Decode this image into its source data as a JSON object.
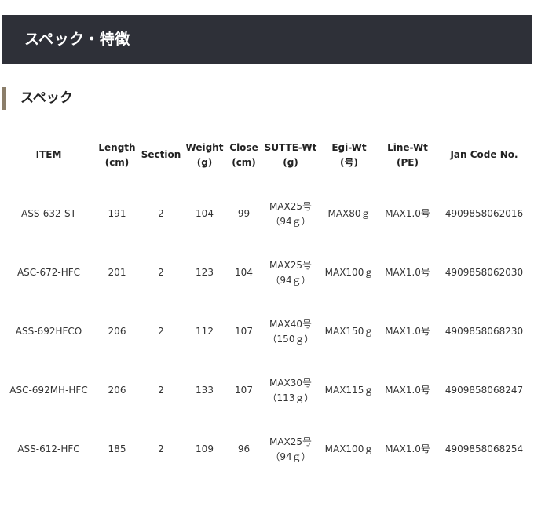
{
  "header": {
    "title": "スペック・特徴"
  },
  "section": {
    "title": "スペック"
  },
  "table": {
    "columns": [
      [
        "ITEM"
      ],
      [
        "Length",
        "(cm)"
      ],
      [
        "Section"
      ],
      [
        "Weight",
        "(g)"
      ],
      [
        "Close",
        "(cm)"
      ],
      [
        "SUTTE-Wt",
        "(g)"
      ],
      [
        "Egi-Wt",
        "(号)"
      ],
      [
        "Line-Wt",
        "(PE)"
      ],
      [
        "Jan Code No."
      ]
    ],
    "rows": [
      {
        "item": "ASS-632-ST",
        "length": "191",
        "section": "2",
        "weight": "104",
        "close": "99",
        "sutte_wt": [
          "MAX25号",
          "（94ｇ）"
        ],
        "egi_wt": "MAX80ｇ",
        "line_wt": "MAX1.0号",
        "jan": "4909858062016"
      },
      {
        "item": "ASC-672-HFC",
        "length": "201",
        "section": "2",
        "weight": "123",
        "close": "104",
        "sutte_wt": [
          "MAX25号",
          "（94ｇ）"
        ],
        "egi_wt": "MAX100ｇ",
        "line_wt": "MAX1.0号",
        "jan": "4909858062030"
      },
      {
        "item": "ASS-692HFCO",
        "length": "206",
        "section": "2",
        "weight": "112",
        "close": "107",
        "sutte_wt": [
          "MAX40号",
          "（150ｇ）"
        ],
        "egi_wt": "MAX150ｇ",
        "line_wt": "MAX1.0号",
        "jan": "4909858068230"
      },
      {
        "item": "ASC-692MH-HFC",
        "length": "206",
        "section": "2",
        "weight": "133",
        "close": "107",
        "sutte_wt": [
          "MAX30号",
          "（113ｇ）"
        ],
        "egi_wt": "MAX115ｇ",
        "line_wt": "MAX1.0号",
        "jan": "4909858068247"
      },
      {
        "item": "ASS-612-HFC",
        "length": "185",
        "section": "2",
        "weight": "109",
        "close": "96",
        "sutte_wt": [
          "MAX25号",
          "（94ｇ）"
        ],
        "egi_wt": "MAX100ｇ",
        "line_wt": "MAX1.0号",
        "jan": "4909858068254"
      }
    ]
  },
  "colors": {
    "header_bg": "#2e3038",
    "header_text": "#ffffff",
    "section_marker": "#8b7e6a",
    "text": "#222222"
  }
}
